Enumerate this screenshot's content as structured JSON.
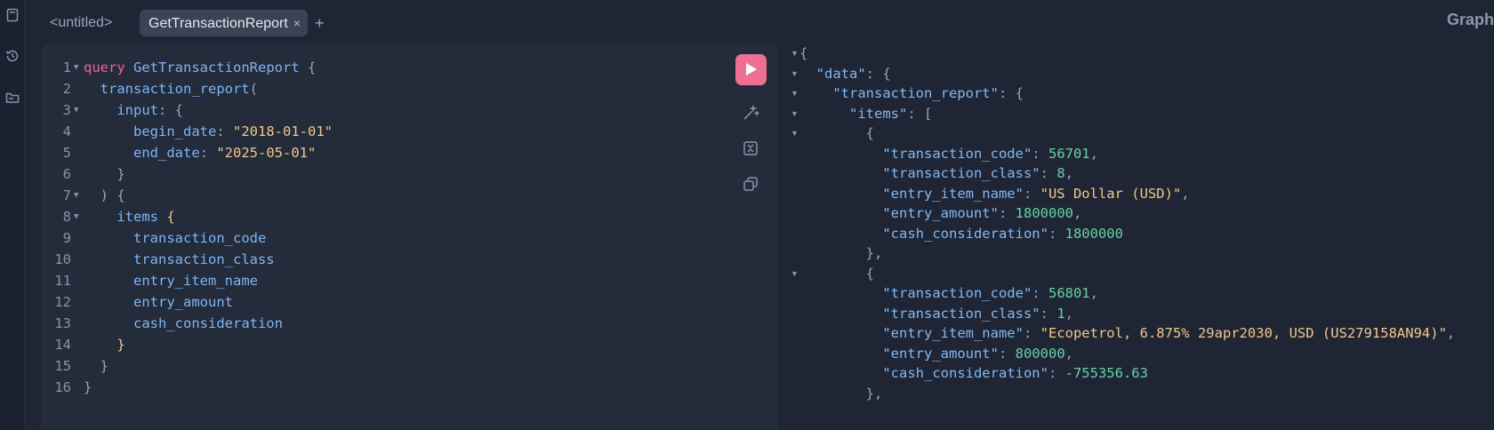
{
  "tabs": [
    {
      "label": "<untitled>",
      "active": false
    },
    {
      "label": "GetTransactionReport",
      "active": true,
      "close": "×"
    }
  ],
  "add_tab_label": "+",
  "brand": "GraphiQL",
  "editor": {
    "lines": [
      {
        "n": "1",
        "fold": true,
        "tokens": [
          [
            "kw",
            "query"
          ],
          [
            "",
            " "
          ],
          [
            "nm",
            "GetTransactionReport"
          ],
          [
            "",
            " "
          ],
          [
            "pn",
            "{"
          ]
        ]
      },
      {
        "n": "2",
        "fold": false,
        "tokens": [
          [
            "",
            "  "
          ],
          [
            "fd",
            "transaction_report"
          ],
          [
            "pn",
            "("
          ]
        ]
      },
      {
        "n": "3",
        "fold": true,
        "tokens": [
          [
            "",
            "    "
          ],
          [
            "ar",
            "input"
          ],
          [
            "pn",
            ": {"
          ]
        ]
      },
      {
        "n": "4",
        "fold": false,
        "tokens": [
          [
            "",
            "      "
          ],
          [
            "ar",
            "begin_date"
          ],
          [
            "pn",
            ": "
          ],
          [
            "st",
            "\"2018-01-01\""
          ]
        ]
      },
      {
        "n": "5",
        "fold": false,
        "tokens": [
          [
            "",
            "      "
          ],
          [
            "ar",
            "end_date"
          ],
          [
            "pn",
            ": "
          ],
          [
            "st",
            "\"2025-05-01\""
          ]
        ]
      },
      {
        "n": "6",
        "fold": false,
        "tokens": [
          [
            "",
            "    "
          ],
          [
            "pn",
            "}"
          ]
        ]
      },
      {
        "n": "7",
        "fold": true,
        "tokens": [
          [
            "",
            "  "
          ],
          [
            "pn",
            ") {"
          ]
        ]
      },
      {
        "n": "8",
        "fold": true,
        "tokens": [
          [
            "",
            "    "
          ],
          [
            "fd",
            "items"
          ],
          [
            "",
            " "
          ],
          [
            "yb",
            "{"
          ]
        ]
      },
      {
        "n": "9",
        "fold": false,
        "tokens": [
          [
            "",
            "      "
          ],
          [
            "fd",
            "transaction_code"
          ]
        ]
      },
      {
        "n": "10",
        "fold": false,
        "tokens": [
          [
            "",
            "      "
          ],
          [
            "fd",
            "transaction_class"
          ]
        ]
      },
      {
        "n": "11",
        "fold": false,
        "tokens": [
          [
            "",
            "      "
          ],
          [
            "fd",
            "entry_item_name"
          ]
        ]
      },
      {
        "n": "12",
        "fold": false,
        "tokens": [
          [
            "",
            "      "
          ],
          [
            "fd",
            "entry_amount"
          ]
        ]
      },
      {
        "n": "13",
        "fold": false,
        "tokens": [
          [
            "",
            "      "
          ],
          [
            "fd",
            "cash_consideration"
          ]
        ]
      },
      {
        "n": "14",
        "fold": false,
        "tokens": [
          [
            "",
            "    "
          ],
          [
            "yb",
            "}"
          ]
        ]
      },
      {
        "n": "15",
        "fold": false,
        "tokens": [
          [
            "",
            "  "
          ],
          [
            "pn",
            "}"
          ]
        ]
      },
      {
        "n": "16",
        "fold": false,
        "tokens": [
          [
            "pn",
            "}"
          ]
        ]
      }
    ]
  },
  "toolbar": {
    "run_icon": "play-icon",
    "prettify_icon": "magic-wand-icon",
    "merge_icon": "merge-fragments-icon",
    "copy_icon": "copy-icon"
  },
  "result": {
    "lines": [
      {
        "fold": true,
        "tokens": [
          [
            "pn",
            "{"
          ]
        ]
      },
      {
        "fold": true,
        "tokens": [
          [
            "",
            "  "
          ],
          [
            "key",
            "\"data\""
          ],
          [
            "pn",
            ": {"
          ]
        ]
      },
      {
        "fold": true,
        "tokens": [
          [
            "",
            "    "
          ],
          [
            "key",
            "\"transaction_report\""
          ],
          [
            "pn",
            ": {"
          ]
        ]
      },
      {
        "fold": true,
        "tokens": [
          [
            "",
            "      "
          ],
          [
            "key",
            "\"items\""
          ],
          [
            "pn",
            ": ["
          ]
        ]
      },
      {
        "fold": true,
        "tokens": [
          [
            "",
            "        "
          ],
          [
            "pn",
            "{"
          ]
        ]
      },
      {
        "fold": false,
        "tokens": [
          [
            "",
            "          "
          ],
          [
            "key",
            "\"transaction_code\""
          ],
          [
            "pn",
            ": "
          ],
          [
            "num",
            "56701"
          ],
          [
            "pn",
            ","
          ]
        ]
      },
      {
        "fold": false,
        "tokens": [
          [
            "",
            "          "
          ],
          [
            "key",
            "\"transaction_class\""
          ],
          [
            "pn",
            ": "
          ],
          [
            "num",
            "8"
          ],
          [
            "pn",
            ","
          ]
        ]
      },
      {
        "fold": false,
        "tokens": [
          [
            "",
            "          "
          ],
          [
            "key",
            "\"entry_item_name\""
          ],
          [
            "pn",
            ": "
          ],
          [
            "str",
            "\"US Dollar (USD)\""
          ],
          [
            "pn",
            ","
          ]
        ]
      },
      {
        "fold": false,
        "tokens": [
          [
            "",
            "          "
          ],
          [
            "key",
            "\"entry_amount\""
          ],
          [
            "pn",
            ": "
          ],
          [
            "num",
            "1800000"
          ],
          [
            "pn",
            ","
          ]
        ]
      },
      {
        "fold": false,
        "tokens": [
          [
            "",
            "          "
          ],
          [
            "key",
            "\"cash_consideration\""
          ],
          [
            "pn",
            ": "
          ],
          [
            "num",
            "1800000"
          ]
        ]
      },
      {
        "fold": false,
        "tokens": [
          [
            "",
            "        "
          ],
          [
            "pn",
            "},"
          ]
        ]
      },
      {
        "fold": true,
        "tokens": [
          [
            "",
            "        "
          ],
          [
            "pn",
            "{"
          ]
        ]
      },
      {
        "fold": false,
        "tokens": [
          [
            "",
            "          "
          ],
          [
            "key",
            "\"transaction_code\""
          ],
          [
            "pn",
            ": "
          ],
          [
            "num",
            "56801"
          ],
          [
            "pn",
            ","
          ]
        ]
      },
      {
        "fold": false,
        "tokens": [
          [
            "",
            "          "
          ],
          [
            "key",
            "\"transaction_class\""
          ],
          [
            "pn",
            ": "
          ],
          [
            "num",
            "1"
          ],
          [
            "pn",
            ","
          ]
        ]
      },
      {
        "fold": false,
        "tokens": [
          [
            "",
            "          "
          ],
          [
            "key",
            "\"entry_item_name\""
          ],
          [
            "pn",
            ": "
          ],
          [
            "str",
            "\"Ecopetrol, 6.875% 29apr2030, USD (US279158AN94)\""
          ],
          [
            "pn",
            ","
          ]
        ]
      },
      {
        "fold": false,
        "tokens": [
          [
            "",
            "          "
          ],
          [
            "key",
            "\"entry_amount\""
          ],
          [
            "pn",
            ": "
          ],
          [
            "num",
            "800000"
          ],
          [
            "pn",
            ","
          ]
        ]
      },
      {
        "fold": false,
        "tokens": [
          [
            "",
            "          "
          ],
          [
            "key",
            "\"cash_consideration\""
          ],
          [
            "pn",
            ": "
          ],
          [
            "neg",
            "-755356.63"
          ]
        ]
      },
      {
        "fold": false,
        "tokens": [
          [
            "",
            "        "
          ],
          [
            "pn",
            "},"
          ]
        ]
      }
    ]
  }
}
